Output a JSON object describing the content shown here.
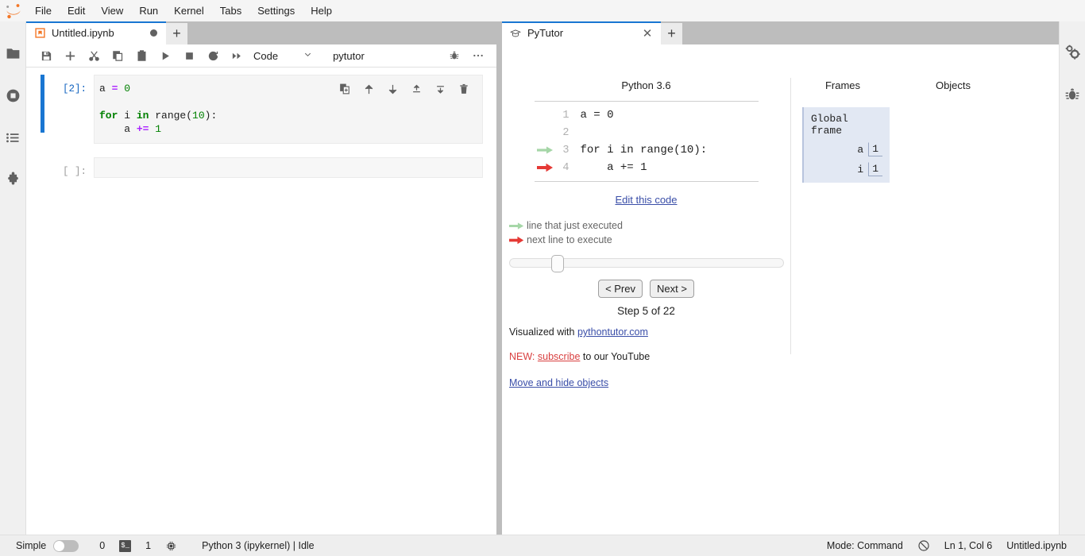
{
  "menubar": {
    "logo_icon": "jupyter-logo-icon",
    "items": [
      "File",
      "Edit",
      "View",
      "Run",
      "Kernel",
      "Tabs",
      "Settings",
      "Help"
    ]
  },
  "left_sidebar": {
    "items": [
      {
        "name": "file-browser",
        "icon": "folder-icon"
      },
      {
        "name": "running-sessions",
        "icon": "running-circle-icon"
      },
      {
        "name": "commands",
        "icon": "list-icon"
      },
      {
        "name": "extension-manager",
        "icon": "puzzle-icon"
      }
    ]
  },
  "right_sidebar": {
    "items": [
      {
        "name": "property-inspector",
        "icon": "gears-icon"
      },
      {
        "name": "debugger",
        "icon": "bug-icon"
      }
    ]
  },
  "notebook_panel": {
    "tab": {
      "icon": "notebook-icon",
      "label": "Untitled.ipynb",
      "dirty_indicator": "●",
      "add_label": "+"
    },
    "toolbar": {
      "buttons": [
        {
          "name": "save-button",
          "icon": "save-icon"
        },
        {
          "name": "insert-cell-button",
          "icon": "plus-icon"
        },
        {
          "name": "cut-cell-button",
          "icon": "scissors-icon"
        },
        {
          "name": "copy-cell-button",
          "icon": "copy-icon"
        },
        {
          "name": "paste-cell-button",
          "icon": "paste-icon"
        },
        {
          "name": "run-cell-button",
          "icon": "play-icon"
        },
        {
          "name": "interrupt-kernel-button",
          "icon": "stop-icon"
        },
        {
          "name": "restart-kernel-button",
          "icon": "refresh-icon"
        },
        {
          "name": "restart-run-all-button",
          "icon": "fast-forward-icon"
        }
      ],
      "cell_type": "Code",
      "cell_type_chevron": "⌄",
      "kernel_name": "pytutor",
      "debug_icon": "bug-icon",
      "overflow_icon": "ellipsis-icon"
    },
    "cells": [
      {
        "prompt": "[2]:",
        "selected": true,
        "lines": [
          [
            {
              "t": "a ",
              "c": "fn"
            },
            {
              "t": "=",
              "c": "op"
            },
            {
              "t": " ",
              "c": "fn"
            },
            {
              "t": "0",
              "c": "num"
            }
          ],
          [],
          [
            {
              "t": "for",
              "c": "kw"
            },
            {
              "t": " i ",
              "c": "fn"
            },
            {
              "t": "in",
              "c": "kw"
            },
            {
              "t": " range(",
              "c": "fn"
            },
            {
              "t": "10",
              "c": "num"
            },
            {
              "t": "):",
              "c": "fn"
            }
          ],
          [
            {
              "t": "    a ",
              "c": "fn"
            },
            {
              "t": "+=",
              "c": "op"
            },
            {
              "t": " ",
              "c": "fn"
            },
            {
              "t": "1",
              "c": "num"
            }
          ]
        ],
        "tools": [
          {
            "name": "duplicate-cell-button",
            "icon": "duplicate-icon"
          },
          {
            "name": "move-cell-up-button",
            "icon": "arrow-up-icon"
          },
          {
            "name": "move-cell-down-button",
            "icon": "arrow-down-icon"
          },
          {
            "name": "insert-cell-above-button",
            "icon": "insert-above-icon"
          },
          {
            "name": "insert-cell-below-button",
            "icon": "insert-below-icon"
          },
          {
            "name": "delete-cell-button",
            "icon": "trash-icon"
          }
        ]
      },
      {
        "prompt": "[ ]:",
        "selected": false,
        "lines": []
      }
    ]
  },
  "pytutor_panel": {
    "tab": {
      "icon": "graduation-cap-icon",
      "label": "PyTutor",
      "close_label": "✕",
      "add_label": "+"
    },
    "version": "Python 3.6",
    "code_lines": [
      {
        "no": "1",
        "text": "a = 0",
        "arrow": "none"
      },
      {
        "no": "2",
        "text": "",
        "arrow": "none"
      },
      {
        "no": "3",
        "text": "for i in range(10):",
        "arrow": "green"
      },
      {
        "no": "4",
        "text": "    a += 1",
        "arrow": "red"
      }
    ],
    "edit_link": "Edit this code",
    "legend": [
      {
        "arrow": "green",
        "text": "line that just executed"
      },
      {
        "arrow": "red",
        "text": "next line to execute"
      }
    ],
    "slider": {
      "position_percent": 16,
      "name": "step-slider"
    },
    "prev_label": "< Prev",
    "next_label": "Next >",
    "step_text": "Step 5 of 22",
    "credit_prefix": "Visualized with ",
    "credit_link": "pythontutor.com",
    "new_tag": "NEW:",
    "subscribe_link": "subscribe",
    "new_suffix": " to our YouTube",
    "move_hide_link": "Move and hide objects",
    "frames_header": "Frames",
    "objects_header": "Objects",
    "global_frame": {
      "title": "Global frame",
      "vars": [
        {
          "name": "a",
          "value": "1"
        },
        {
          "name": "i",
          "value": "1"
        }
      ]
    }
  },
  "statusbar": {
    "simple_label": "Simple",
    "toggle_state": "off",
    "kernel_count": "0",
    "terminal_badge": "$_",
    "terminal_count": "1",
    "memory_icon": "cpu-icon",
    "kernel_status": "Python 3 (ipykernel) | Idle",
    "mode": "Mode: Command",
    "no_conflict_icon": "shield-off-icon",
    "cursor_position": "Ln 1, Col 6",
    "filename": "Untitled.ipynb"
  },
  "colors": {
    "accent": "#1976d2",
    "frame_bg": "#e2e8f3",
    "green_arrow": "#a5d6a7",
    "red_arrow": "#e53935",
    "notebook_icon": "#f37726"
  }
}
